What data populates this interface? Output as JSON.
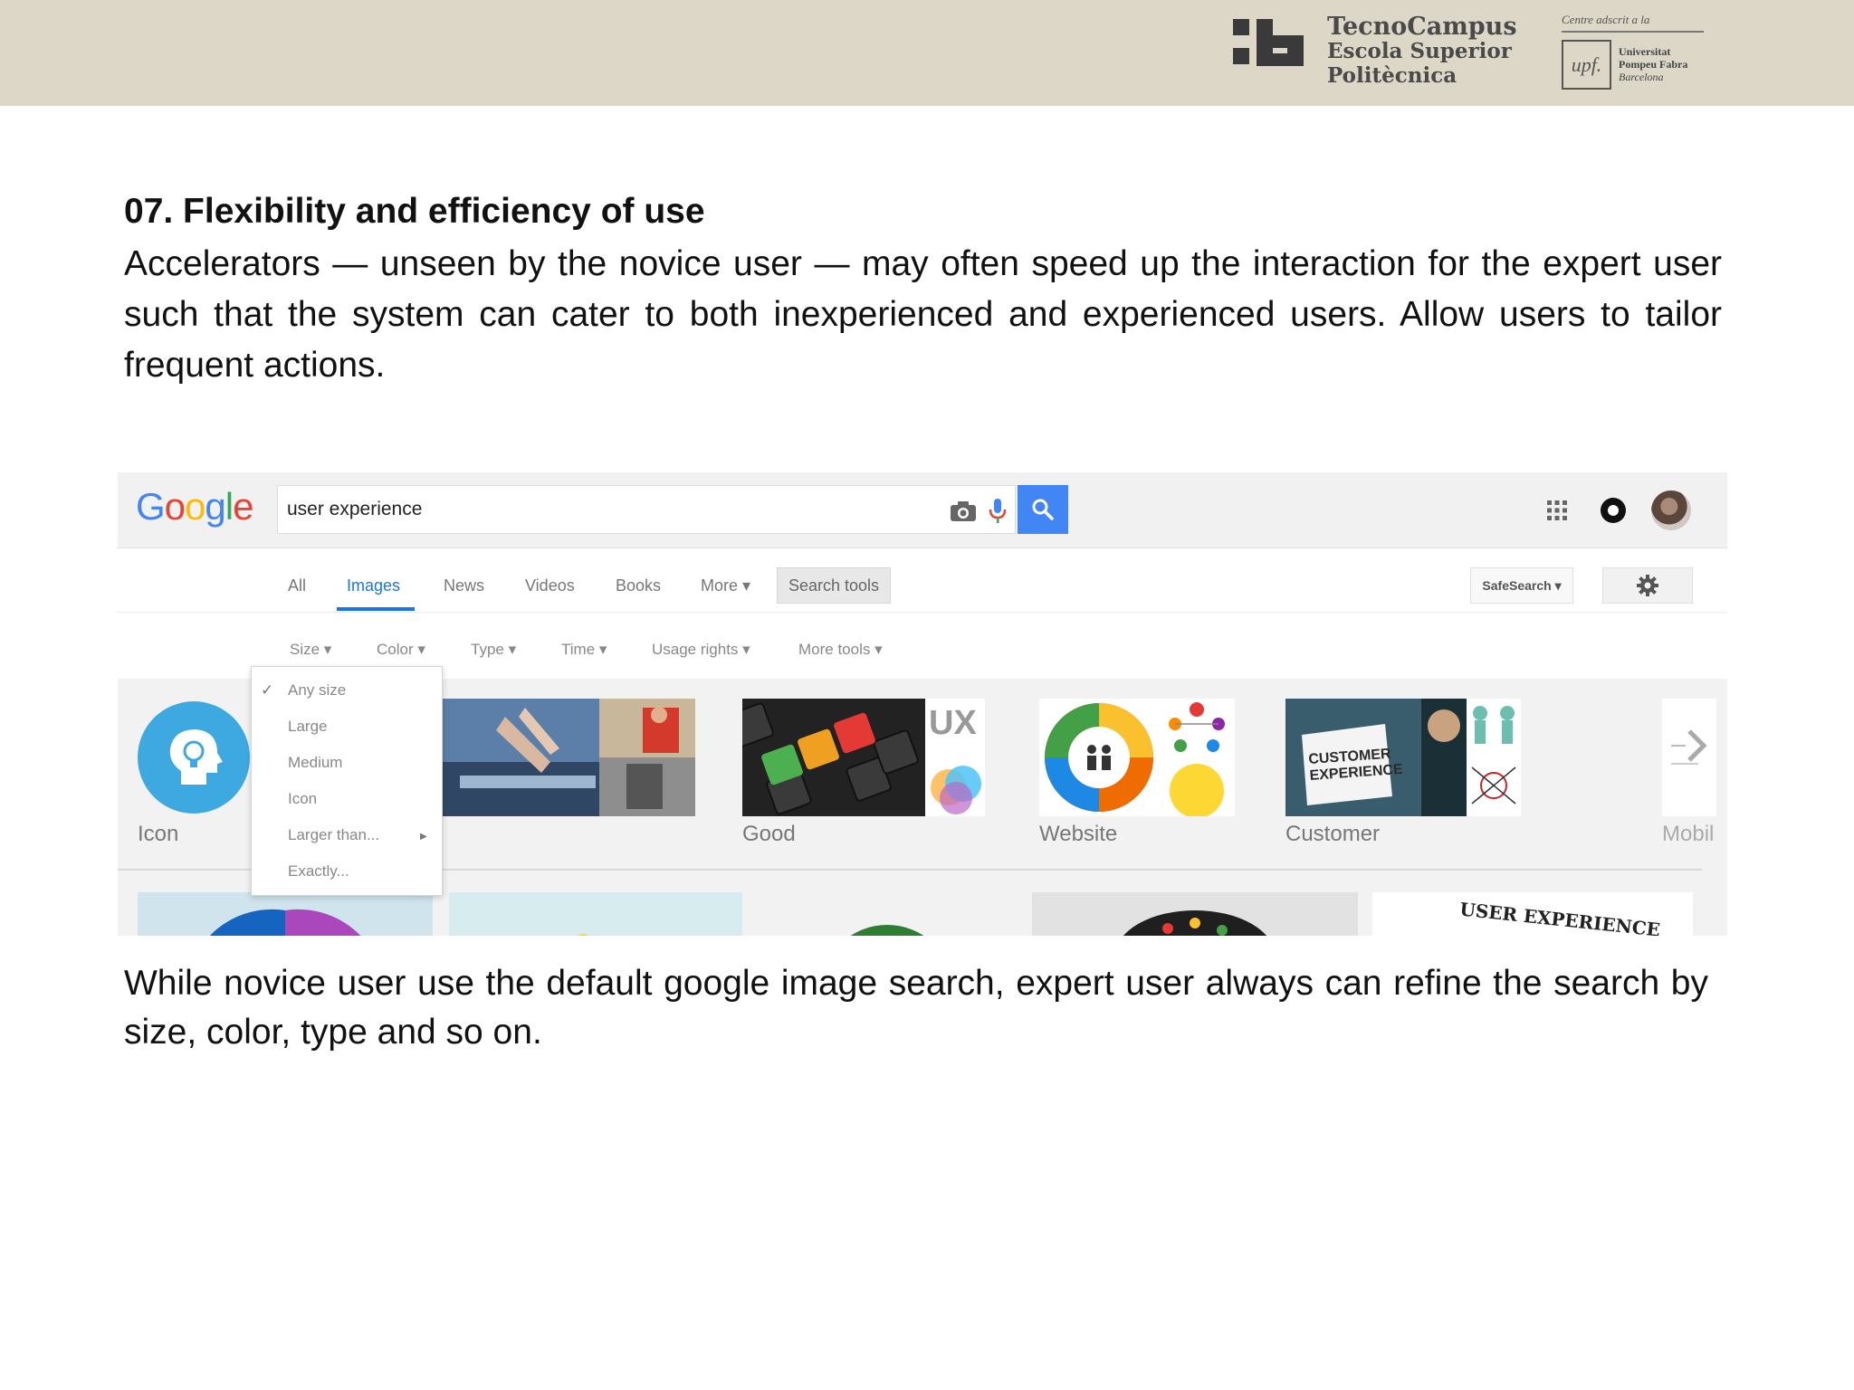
{
  "header": {
    "tecnocampus_line1": "TecnoCampus",
    "tecnocampus_line2": "Escola Superior",
    "tecnocampus_line3": "Politècnica",
    "upf_caption": "Centre adscrit a la",
    "upf_box": "upf.",
    "upf_line1": "Universitat",
    "upf_line2": "Pompeu Fabra",
    "upf_line3": "Barcelona"
  },
  "slide": {
    "title": "07. Flexibility and efficiency of use",
    "body": "Accelerators — unseen by the novice user — may often speed up the interaction for the expert user such that the system can cater to both inexperienced and experienced users. Allow users to tailor frequent actions.",
    "caption": "While novice user use the default google image search, expert user always can refine the search by size, color, type and so on."
  },
  "screenshot": {
    "logo_letters": [
      "G",
      "o",
      "o",
      "g",
      "l",
      "e"
    ],
    "search_value": "user experience",
    "tabs": [
      "All",
      "Images",
      "News",
      "Videos",
      "Books",
      "More ▾"
    ],
    "search_tools": "Search tools",
    "safesearch": "SafeSearch ▾",
    "filters": [
      "Size ▾",
      "Color ▾",
      "Type ▾",
      "Time ▾",
      "Usage rights ▾",
      "More tools ▾"
    ],
    "size_menu": [
      "Any size",
      "Large",
      "Medium",
      "Icon",
      "Larger than...",
      "Exactly..."
    ],
    "size_menu_check": "✓",
    "size_menu_arrow": "▶",
    "result_labels": [
      "Icon",
      "Good",
      "Website",
      "Customer",
      "Mobil"
    ],
    "thumb_text_ux": "UX",
    "thumb_text_customer": "CUSTOMER EXPERIENCE",
    "thumb_text_user_experience": "USER EXPERIENCE",
    "colors": {
      "accent_blue": "#4285f4",
      "active_tab": "#1a73e8",
      "header_band": "#dcd7c6"
    }
  }
}
